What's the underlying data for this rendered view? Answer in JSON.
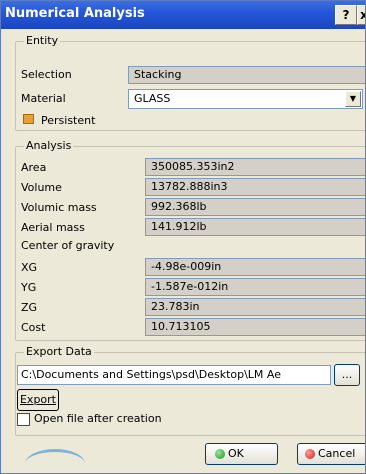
{
  "window": {
    "title": "Numerical Analysis",
    "help_label": "?",
    "close_label": "x"
  },
  "entity": {
    "legend": "Entity",
    "selection_label": "Selection",
    "selection_value": "Stacking",
    "material_label": "Material",
    "material_value": "GLASS",
    "persistent_label": "Persistent"
  },
  "analysis": {
    "legend": "Analysis",
    "area_label": "Area",
    "area_value": "350085.353in2",
    "volume_label": "Volume",
    "volume_value": "13782.888in3",
    "volumic_mass_label": "Volumic mass",
    "volumic_mass_value": "992.368lb",
    "aerial_mass_label": "Aerial mass",
    "aerial_mass_value": "141.912lb",
    "cog_label": "Center of gravity",
    "xg_label": "XG",
    "xg_value": "-4.98e-009in",
    "yg_label": "YG",
    "yg_value": "-1.587e-012in",
    "zg_label": "ZG",
    "zg_value": "23.783in",
    "cost_label": "Cost",
    "cost_value": "10.713105"
  },
  "export": {
    "legend": "Export Data",
    "path_value": "C:\\Documents and Settings\\psd\\Desktop\\LM Ae",
    "browse_label": "...",
    "export_label": "Export",
    "open_after_label": "Open file after creation"
  },
  "buttons": {
    "ok_label": "OK",
    "cancel_label": "Cancel"
  },
  "colors": {
    "titlebar": "#2457d8",
    "dialog_bg": "#ece9d8",
    "ok_icon": "#1a9a1a",
    "cancel_icon": "#d21e1e",
    "pin_icon": "#e9a030"
  }
}
